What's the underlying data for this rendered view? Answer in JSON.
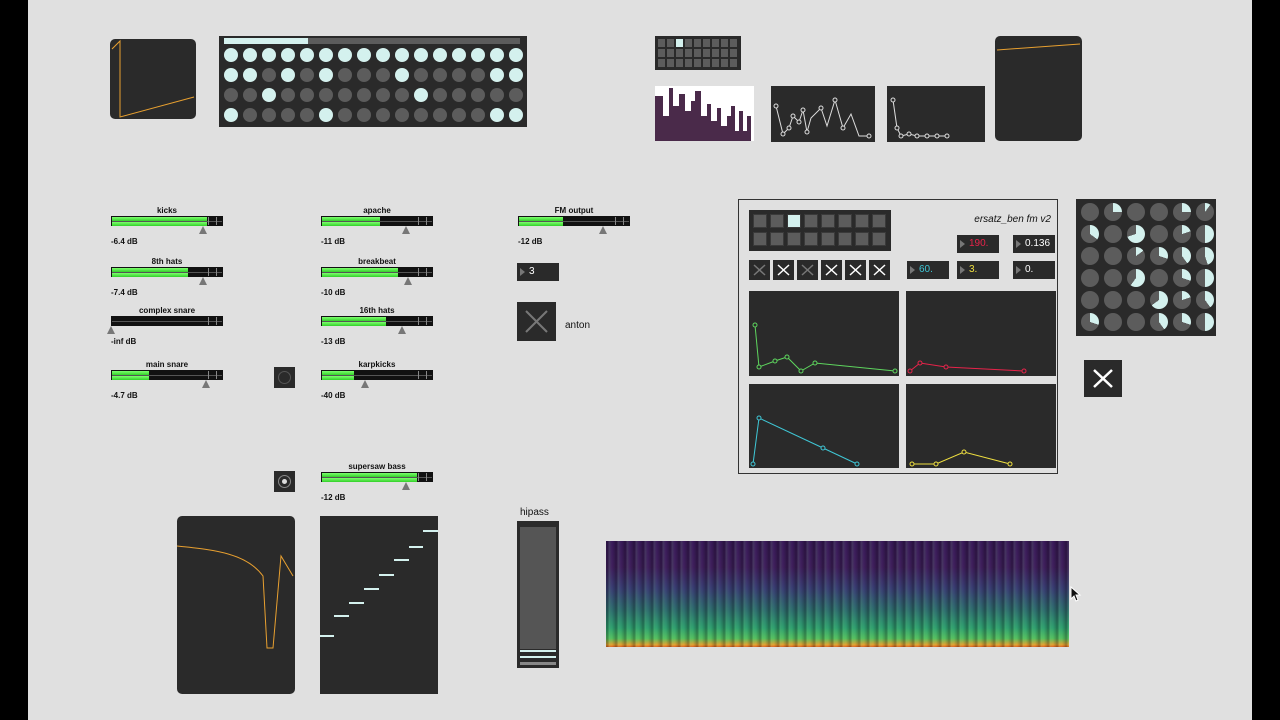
{
  "meters": [
    {
      "name": "kicks",
      "db": "-6.4 dB",
      "level": 0.86,
      "thumb": 0.84
    },
    {
      "name": "8th hats",
      "db": "-7.4 dB",
      "level": 0.69,
      "thumb": 0.84
    },
    {
      "name": "complex snare",
      "db": "-inf dB",
      "level": 0.0,
      "thumb": 0.0
    },
    {
      "name": "main snare",
      "db": "-4.7 dB",
      "level": 0.34,
      "thumb": 0.86
    },
    {
      "name": "apache",
      "db": "-11 dB",
      "level": 0.53,
      "thumb": 0.77
    },
    {
      "name": "breakbeat",
      "db": "-10 dB",
      "level": 0.69,
      "thumb": 0.79
    },
    {
      "name": "16th hats",
      "db": "-13 dB",
      "level": 0.58,
      "thumb": 0.74
    },
    {
      "name": "karpkicks",
      "db": "-40 dB",
      "level": 0.29,
      "thumb": 0.4
    },
    {
      "name": "supersaw bass",
      "db": "-12 dB",
      "level": 0.86,
      "thumb": 0.77
    },
    {
      "name": "FM output",
      "db": "-12 dB",
      "level": 0.4,
      "thumb": 0.77
    }
  ],
  "number_box_3": "3",
  "anton_label": "anton",
  "hipass_label": "hipass",
  "fm": {
    "title": "ersatz_ben fm v2",
    "val_190": "190.",
    "val_0136": "0.136",
    "val_60": "60.",
    "val_3": "3.",
    "val_0": "0.",
    "colors": {
      "red": "#e8234a",
      "cyan": "#3fc7d6",
      "yellow": "#f0e040",
      "green": "#5ed65e"
    }
  },
  "colors": {
    "cell_on": "#d4f1ee",
    "cell_off": "#5c5c5c",
    "bg": "#e0e0e0",
    "panel": "#2a2a2a",
    "orange": "#e8a030"
  },
  "seq_grid": [
    [
      1,
      1,
      1,
      1,
      1,
      1,
      1,
      1,
      1,
      1,
      1,
      1,
      1,
      1,
      1,
      1,
      1,
      1,
      1,
      1,
      1,
      1,
      1,
      1,
      1
    ],
    [
      1,
      1,
      0,
      1,
      0,
      1,
      0,
      0,
      0,
      1,
      0,
      0,
      0,
      0,
      1,
      1,
      0,
      0,
      1,
      0,
      0,
      0,
      0,
      0,
      0
    ],
    [
      0,
      0,
      1,
      0,
      0,
      0,
      0,
      0,
      0,
      0,
      1,
      0,
      0,
      0,
      0,
      0,
      0,
      0,
      0,
      0,
      0,
      0,
      0,
      0,
      0
    ],
    [
      1,
      0,
      0,
      0,
      0,
      1,
      0,
      0,
      0,
      0,
      0,
      0,
      0,
      0,
      1,
      1,
      0,
      0,
      0,
      0,
      0,
      0,
      0,
      0,
      0
    ]
  ]
}
